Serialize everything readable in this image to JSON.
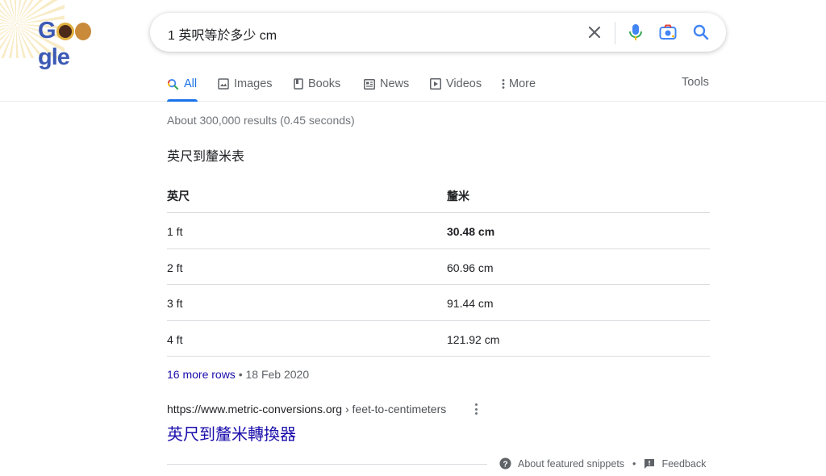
{
  "header": {
    "logo_letters": [
      "G",
      "g",
      "l",
      "e"
    ],
    "search": {
      "query": "1 英呎等於多少 cm"
    },
    "tabs": [
      {
        "label": "All",
        "icon": "search-icon",
        "active": true
      },
      {
        "label": "Images",
        "icon": "image-icon"
      },
      {
        "label": "Books",
        "icon": "book-icon"
      },
      {
        "label": "News",
        "icon": "news-icon"
      },
      {
        "label": "Videos",
        "icon": "video-icon"
      },
      {
        "label": "More",
        "icon": "more-vert-icon"
      }
    ],
    "tools_label": "Tools"
  },
  "results": {
    "stats": "About 300,000 results (0.45 seconds)",
    "snippet": {
      "title": "英尺到釐米表",
      "columns": [
        "英尺",
        "釐米"
      ],
      "rows": [
        [
          "1 ft",
          "30.48 cm"
        ],
        [
          "2 ft",
          "60.96 cm"
        ],
        [
          "3 ft",
          "91.44 cm"
        ],
        [
          "4 ft",
          "121.92 cm"
        ]
      ],
      "more_rows_label": "16 more rows",
      "date": "18 Feb 2020",
      "cite_domain": "https://www.metric-conversions.org",
      "cite_path": " › feet-to-centimeters",
      "result_title": "英尺到釐米轉換器"
    },
    "footer": {
      "about_label": "About featured snippets",
      "feedback_label": "Feedback"
    }
  },
  "colors": {
    "accent": "#1a73e8",
    "link": "#1a0dab",
    "muted": "#70757a"
  }
}
